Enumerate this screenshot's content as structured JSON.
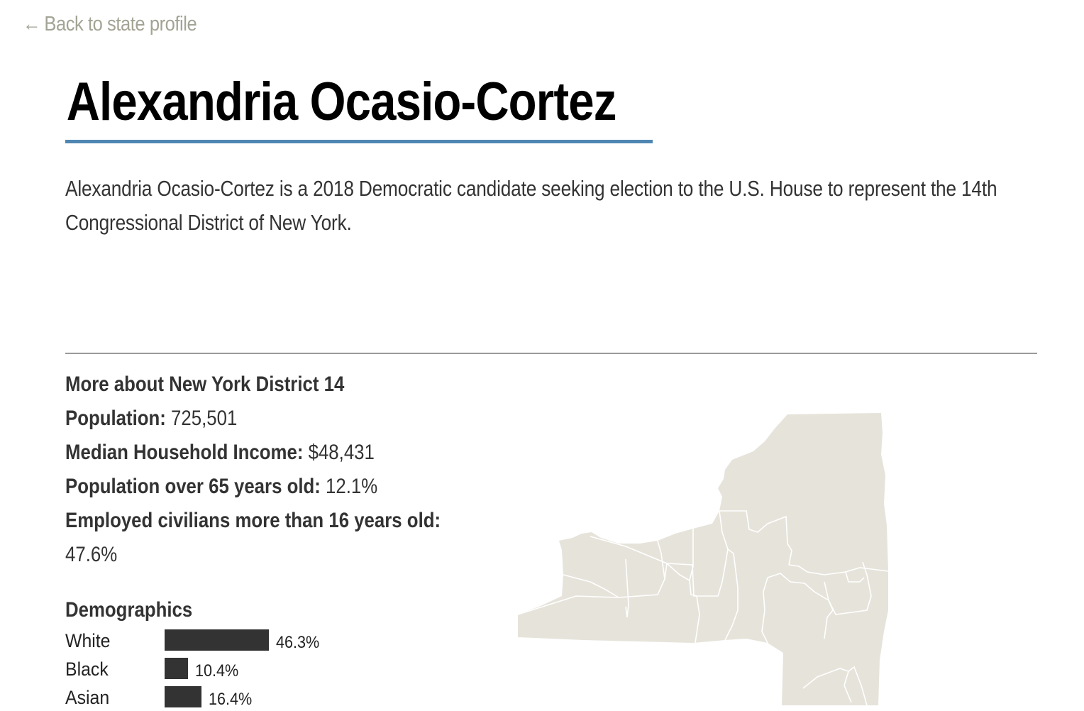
{
  "nav": {
    "back_arrow": "←",
    "back_label": "Back to state profile"
  },
  "candidate": {
    "name": "Alexandria Ocasio-Cortez",
    "intro": "Alexandria Ocasio-Cortez is a 2018 Democratic candidate seeking election to the U.S. House to represent the 14th Congressional District of New York."
  },
  "district": {
    "heading": "More about New York District 14",
    "facts": [
      {
        "label": "Population:",
        "value": "725,501"
      },
      {
        "label": "Median Household Income:",
        "value": "$48,431"
      },
      {
        "label": "Population over 65 years old:",
        "value": "12.1%"
      },
      {
        "label": "Employed civilians more than 16 years old:",
        "value": "47.6%"
      }
    ]
  },
  "demographics": {
    "title": "Demographics",
    "rows": [
      {
        "label": "White",
        "value": "46.3%",
        "pct": 46.3
      },
      {
        "label": "Black",
        "value": "10.4%",
        "pct": 10.4
      },
      {
        "label": "Asian",
        "value": "16.4%",
        "pct": 16.4
      }
    ]
  },
  "map": {
    "icon": "new-york-state-district-map",
    "fill": "#e6e3da",
    "stroke": "#ffffff"
  }
}
